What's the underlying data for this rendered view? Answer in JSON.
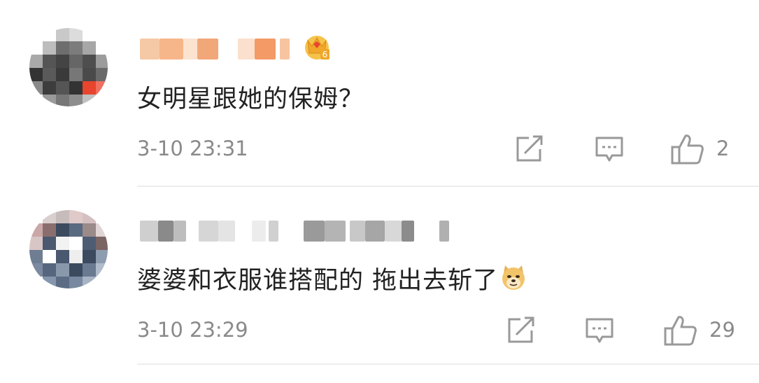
{
  "comments": [
    {
      "text": "女明星跟她的保姆？",
      "time": "3-10 23:31",
      "likes": "2",
      "badge_level": "6",
      "avatar": "pixelated",
      "username": "blurred"
    },
    {
      "text": "婆婆和衣服谁搭配的 拖出去斩了",
      "emoji": "doge-emoji",
      "time": "3-10 23:29",
      "likes": "29",
      "avatar": "pixelated",
      "username": "blurred"
    }
  ],
  "icons": {
    "share": "share-icon",
    "reply": "comment-icon",
    "like": "thumbs-up-icon",
    "badge": "crown-icon"
  },
  "colors": {
    "text": "#222222",
    "meta": "#8a8a8a",
    "icon": "#999999",
    "divider": "#ededed",
    "badge": "#f0a72a"
  }
}
